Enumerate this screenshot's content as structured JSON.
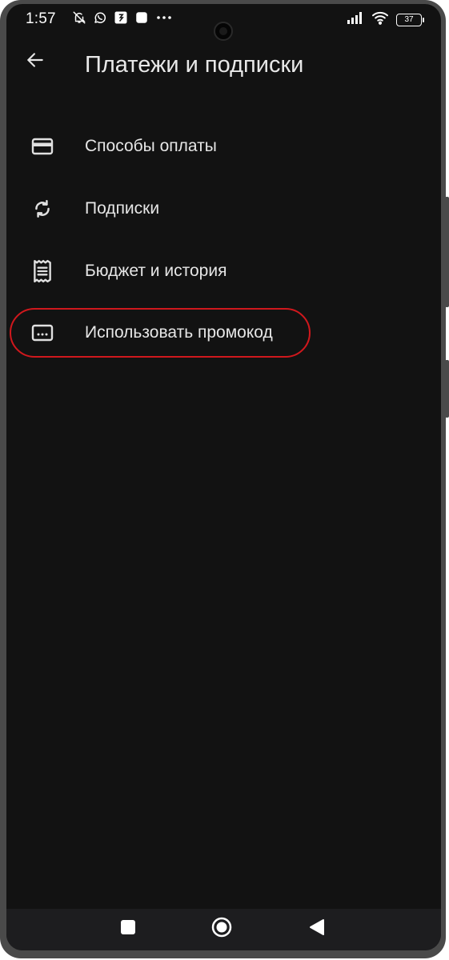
{
  "status_bar": {
    "time": "1:57",
    "icons_left": [
      "muted-bell-icon",
      "whatsapp-icon",
      "app-badge-icon",
      "square-notification-icon",
      "more-notifications-icon"
    ],
    "icons_right": [
      "signal-icon",
      "wifi-icon",
      "battery-icon"
    ],
    "battery_level": "37"
  },
  "header": {
    "title": "Платежи и подписки",
    "back_icon": "arrow-left-icon"
  },
  "menu": {
    "items": [
      {
        "label": "Способы оплаты",
        "icon": "credit-card-icon"
      },
      {
        "label": "Подписки",
        "icon": "sync-icon"
      },
      {
        "label": "Бюджет и история",
        "icon": "receipt-icon"
      },
      {
        "label": "Использовать промокод",
        "icon": "promo-code-icon"
      }
    ]
  },
  "highlight": {
    "target": "Использовать промокод",
    "color": "#d0181d"
  },
  "navigation": {
    "buttons": [
      "recent-apps-icon",
      "home-icon",
      "back-icon"
    ]
  },
  "colors": {
    "background": "#121212",
    "text": "#e6e6e6",
    "frame": "#4a4a4a"
  }
}
